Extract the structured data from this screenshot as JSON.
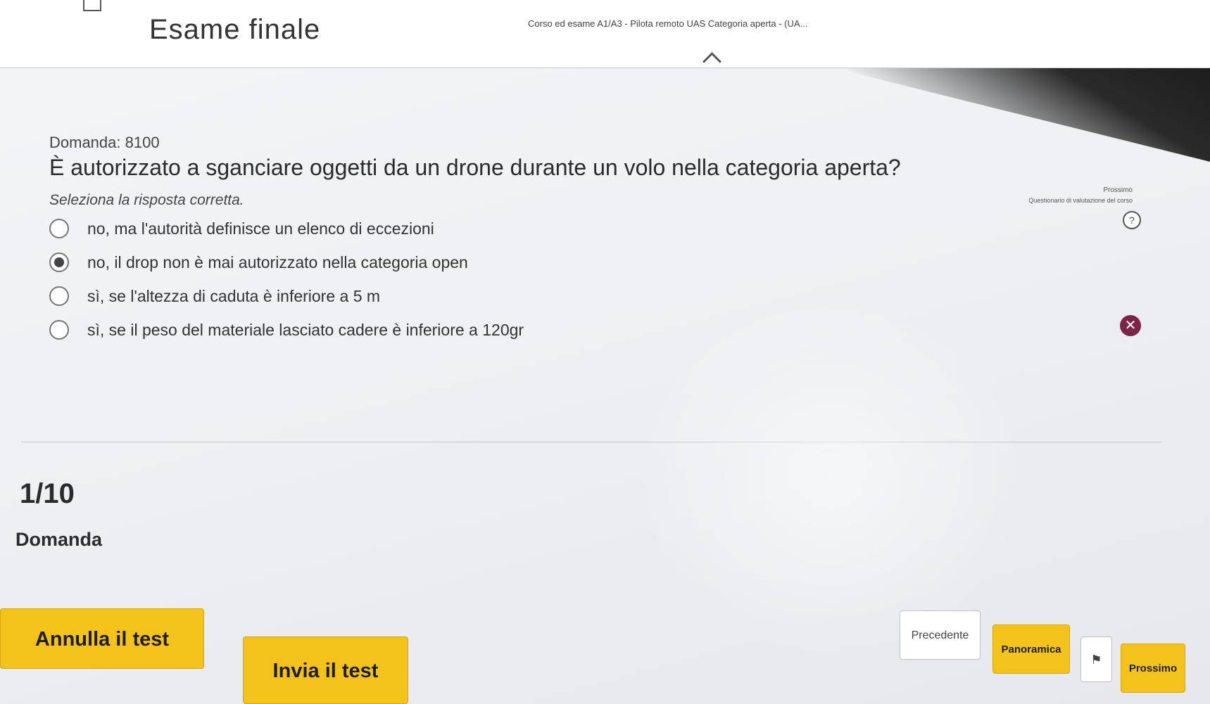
{
  "header": {
    "title": "Esame finale",
    "course": "Corso ed esame A1/A3 - Pilota remoto UAS Categoria aperta - (UA..."
  },
  "toolbar": {
    "next_mini": "Prossimo",
    "survey": "Questionario di valutazione del corso",
    "help": "?",
    "close": "✕"
  },
  "question": {
    "number": "Domanda: 8100",
    "text": "È autorizzato a sganciare oggetti da un drone durante un volo nella categoria aperta?",
    "instruction": "Seleziona la risposta corretta.",
    "answers": [
      {
        "label": "no, ma l'autorità definisce un elenco di eccezioni",
        "selected": false
      },
      {
        "label": "no, il drop non è mai autorizzato nella categoria open",
        "selected": true
      },
      {
        "label": "sì, se l'altezza di caduta è inferiore a 5 m",
        "selected": false
      },
      {
        "label": "sì, se il peso del materiale lasciato cadere è inferiore a 120gr",
        "selected": false
      }
    ]
  },
  "progress": {
    "value": "1/10",
    "label": "Domanda"
  },
  "buttons": {
    "cancel": "Annulla il test",
    "submit": "Invia il test",
    "prev": "Precedente",
    "overview": "Panoramica",
    "flag": "⚑",
    "next": "Prossimo"
  },
  "colors": {
    "accent_yellow": "#f3c21b",
    "close_red": "#7b2447"
  }
}
